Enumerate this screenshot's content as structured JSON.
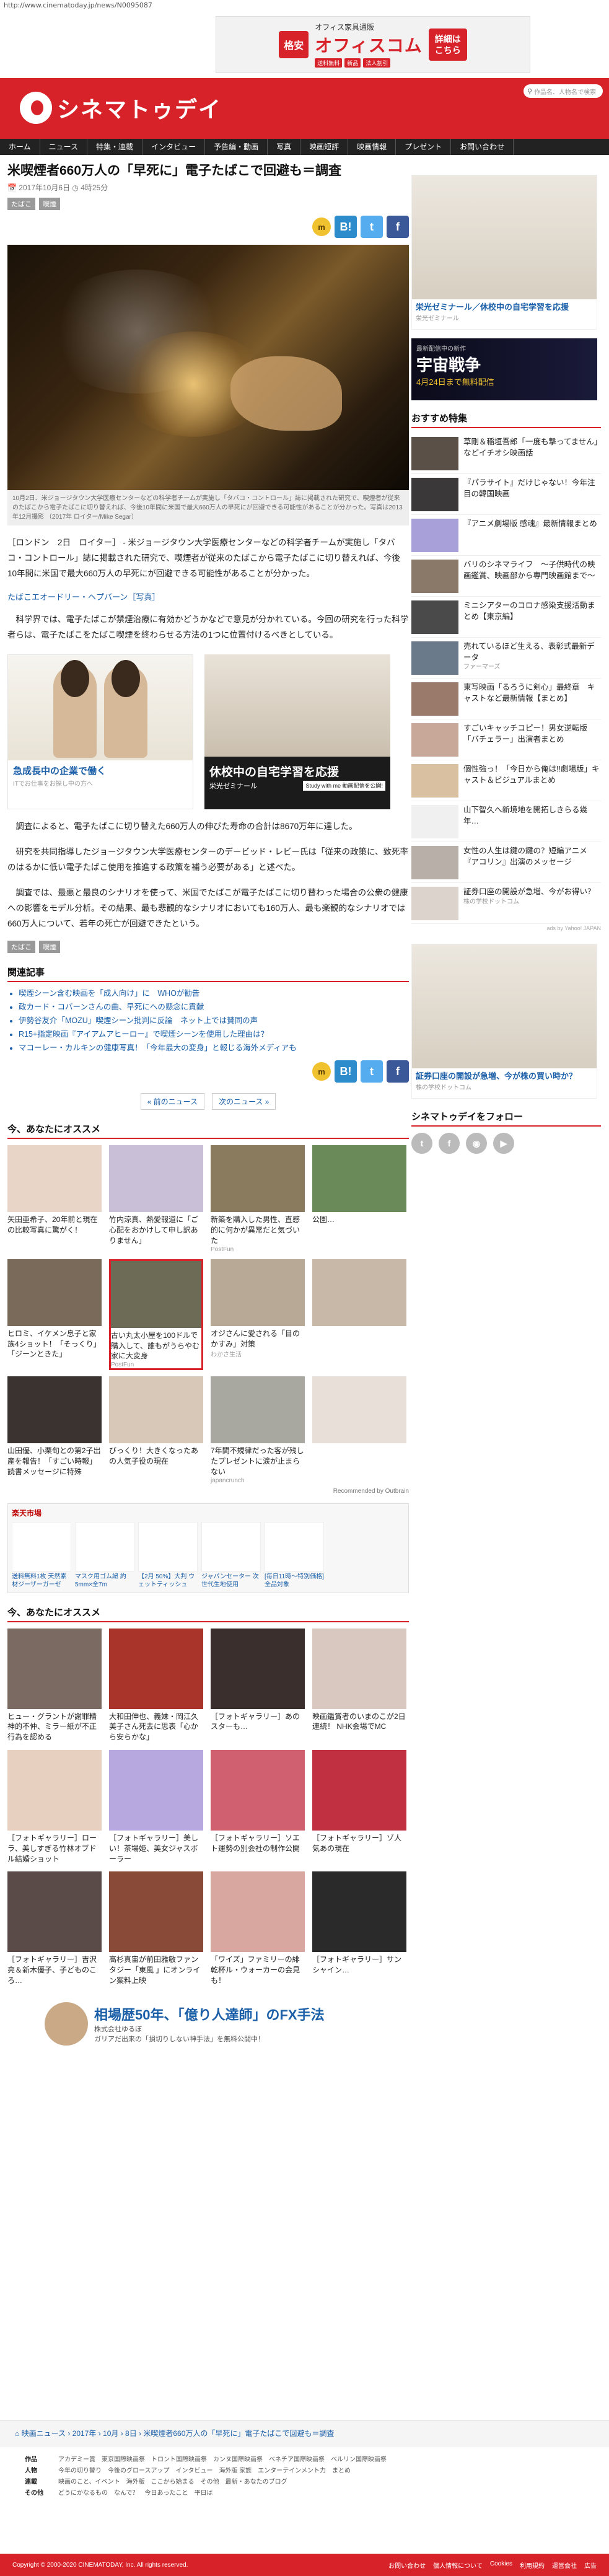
{
  "browser": {
    "url": "http://www.cinematoday.jp/news/N0095087"
  },
  "top_ad": {
    "tag": "格安",
    "sub": "オフィス家具通販",
    "main": "オフィスコム",
    "pills": [
      "送料無料",
      "新品",
      "法人割引"
    ],
    "cta": "詳細は\nこちら"
  },
  "header": {
    "logo_text": "シネマトゥデイ",
    "search_placeholder": "作品名、人物名で検索"
  },
  "nav": [
    "ホーム",
    "ニュース",
    "特集・連載",
    "インタビュー",
    "予告編・動画",
    "写真",
    "映画短評",
    "映画情報",
    "プレゼント",
    "お問い合わせ"
  ],
  "article": {
    "title": "米喫煙者660万人の「早死に」電子たばこで回避も＝調査",
    "date": "2017年10月6日",
    "time": "4時25分",
    "tags": [
      "たばこ",
      "喫煙"
    ],
    "caption": "10月2日、米ジョージタウン大学医療センターなどの科学者チームが実施し「タバコ・コントロール」誌に掲載された研究で、喫煙者が従来のたばこから電子たばこに切り替えれば、今後10年間に米国で最大660万人の早死にが回避できる可能性があることが分かった。写真は2013年12月撮影 （2017年 ロイター/Mike Segar）",
    "p1": "［ロンドン　2日　ロイター］ - 米ジョージタウン大学医療センターなどの科学者チームが実施し「タバコ・コントロール」誌に掲載された研究で、喫煙者が従来のたばこから電子たばこに切り替えれば、今後10年間に米国で最大660万人の早死にが回避できる可能性があることが分かった。",
    "related_link": "たばこエオードリー・ヘプバーン［写真］",
    "p2": "　科学界では、電子たばこが禁煙治療に有効かどうかなどで意見が分かれている。今回の研究を行った科学者らは、電子たばこをたばこ喫煙を終わらせる方法の1つに位置付けるべきとしている。",
    "p3": "　調査によると、電子たばこに切り替えた660万人の伸びた寿命の合計は8670万年に達した。",
    "p4": "　研究を共同指導したジョージタウン大学医療センターのデービッド・レビー氏は「従来の政策に、致死率のはるかに低い電子たばこ使用を推進する政策を補う必要がある」と述べた。",
    "p5": "　調査では、最悪と最良のシナリオを使って、米国でたばこが電子たばこに切り替わった場合の公衆の健康への影響をモデル分析。その結果、最も悲観的なシナリオにおいても160万人、最も楽観的なシナリオでは660万人について、若年の死亡が回避できたという。",
    "pr_label": "[PR]"
  },
  "share": {
    "mixi": "m",
    "hatena": "B!",
    "twitter": "t",
    "facebook": "f"
  },
  "inline_ads": {
    "a_title": "急成長中の企業で働く",
    "a_src": "ITでお仕事をお探し中の方へ",
    "b_text": "休校中の自宅学習を応援",
    "b_brand": "栄光ゼミナール",
    "b_cta": "Study with me 動画配信を公開!"
  },
  "related": {
    "title": "関連記事",
    "items": [
      "喫煙シーン含む映画を「成人向け」に　WHOが勧告",
      "政カード・コバーンさんの曲、早死にへの懸念に貢献",
      "伊勢谷友介「MOZU」喫煙シーン批判に反論　ネット上では賛同の声",
      "R15+指定映画『アイアムアヒーロー』で喫煙シーンを使用した理由は？",
      "マコーレー・カルキンの健康写真！「今年最大の変身」と報じる海外メディアも"
    ]
  },
  "pager": {
    "prev": "« 前のニュース",
    "next": "次のニュース »"
  },
  "rec1": {
    "title": "今、あなたにオススメ",
    "items": [
      {
        "cap": "矢田亜希子、20年前と現在の比較写真に驚がく！",
        "src": ""
      },
      {
        "cap": "竹内涼真、熱愛報道に「ご心配をおかけして申し訳ありません」",
        "src": ""
      },
      {
        "cap": "新築を購入した男性、直感的に何かが異常だと気づいた",
        "src": "PostFun"
      },
      {
        "cap": "公園…",
        "src": ""
      },
      {
        "cap": "ヒロミ、イケメン息子と家族4ショット！「そっくり」「ジーンときた」",
        "src": ""
      },
      {
        "cap": "古い丸太小屋を100ドルで購入して、誰もがうらやむ家に大変身",
        "src": "PostFun"
      },
      {
        "cap": "オジさんに愛される「目のかすみ」対策",
        "src": "わかさ生活"
      },
      {
        "cap": "",
        "src": ""
      },
      {
        "cap": "山田優、小栗旬との第2子出産を報告！「すごい時報」読書メッセージに特殊",
        "src": ""
      },
      {
        "cap": "びっくり！大きくなったあの人気子役の現在",
        "src": ""
      },
      {
        "cap": "7年間不規律だった客が残したプレゼントに涙が止まらない",
        "src": "japancrunch"
      },
      {
        "cap": "",
        "src": ""
      }
    ],
    "recommended_by": "Recommended by Outbrain"
  },
  "rakuten": {
    "head": "楽天市場",
    "items": [
      "送料無料1枚 天然素材ジーザーガーゼ",
      "マスク用ゴム紐 約5mm×全7m",
      "【2月 50%】大判 ウェットティッシュ",
      "ジャパンセーター 次世代生地使用",
      "[毎日11時〜特別価格] 全品対象"
    ]
  },
  "rec2": {
    "title": "今、あなたにオススメ",
    "items": [
      "ヒュー・グラントが謝罪精神的不仲、ミラー紙が不正行為を認める",
      "大和田伸也、義妹・岡江久美子さん死去に思表「心から安らかな」",
      "［フォトギャラリー］あのスターも…",
      "映画鑑賞者のいまのこが2日連続！ NHK会場でMC",
      "［フォトギャラリー］ローラ、美しすぎる竹林オブドル結婚ショット",
      "［フォトギャラリー］美しい！茶場姫、美女ジャスボーラー",
      "［フォトギャラリー］ソエト運勢の別会社の制作公開",
      "［フォトギャラリー］ゾ人気あの現在",
      "［フォトギャラリー］吉沢亮＆新木優子、子どものころ…",
      "高杉真宙が前田雅敏ファンタジー「東風 」にオンライン案料上映",
      "「ワイズ」ファミリーの緋　乾杯ル・ウォーカーの会見も！",
      "［フォトギャラリー］サンシャイン…"
    ]
  },
  "bottom_ad": {
    "title": "相場歴50年、「億り人達師」のFX手法",
    "sub": "株式会社ゆるぼ",
    "desc": "ガリアだ出来の「損切りしない神手法」を無料公開中！"
  },
  "sidebar": {
    "ad1_cap": "栄光ゼミナール／休校中の自宅学習を応援",
    "ad1_src": "栄光ゼミナール",
    "movie_label": "最新配信中の新作",
    "movie_name": "宇宙戦争",
    "movie_date": "4月24日まで無料配信",
    "special_title": "おすすめ特集",
    "specials": [
      {
        "t": "草剛＆稲垣吾郎「一度も撃ってません」などイチオシ映画話",
        "s": ""
      },
      {
        "t": "『パラサイト』だけじゃない！今年注目の韓国映画",
        "s": ""
      },
      {
        "t": "『アニメ劇場版 感魂』最新情報まとめ",
        "s": ""
      },
      {
        "t": "バリのシネマライフ　～子供時代の映画鑑賞、映画部から専門映画館まで～",
        "s": ""
      },
      {
        "t": "ミニシアターのコロナ感染支援活動まとめ【東京編】",
        "s": ""
      },
      {
        "t": "売れているほど生える、表彰式最新データ",
        "s": "ファーマーズ"
      },
      {
        "t": "東写映画「るろうに剣心」最終章　キャストなど最新情報【まとめ】",
        "s": ""
      },
      {
        "t": "すごいキャッチコピー！男女逆転版「バチェラー」出演者まとめ",
        "s": ""
      },
      {
        "t": "個性強っ！「今日から俺は!!劇場版」キャスト＆ビジュアルまとめ",
        "s": ""
      },
      {
        "t": "山下智久へ新境地を開拓しきらる幾年…",
        "s": ""
      },
      {
        "t": "女性の人生は鍵の鍵の？短編アニメ『アコリン』出演のメッセージ",
        "s": ""
      },
      {
        "t": "証券口座の開設が急増、今がお得い？",
        "s": "株の学校ドットコム"
      }
    ],
    "ads_by": "ads by Yahoo! JAPAN",
    "ad2_cap": "証券口座の開設が急増、今が株の買い時か？",
    "ad2_src": "株の学校ドットコム",
    "follow_title": "シネマトゥデイをフォロー",
    "follow_icons": [
      "twitter",
      "facebook",
      "instagram",
      "youtube"
    ]
  },
  "breadcrumb": "映画ニュース › 2017年 › 10月 › 8日 › 米喫煙者660万人の「早死に」電子たばこで回避も＝調査",
  "footer": {
    "rows": [
      {
        "label": "作品",
        "links": [
          "アカデミー賞",
          "東京国際映画祭",
          "トロント国際映画祭",
          "カンヌ国際映画祭",
          "ベネチア国際映画祭",
          "ベルリン国際映画祭"
        ]
      },
      {
        "label": "人物",
        "links": [
          "今年の切り替り",
          "今後のグロースアップ",
          "インタビュー",
          "海外版 家族",
          "エンターテインメント力",
          "まとめ"
        ]
      },
      {
        "label": "連載",
        "links": [
          "映画のこと、イベント",
          "海外版",
          "ここから始まる",
          "その他",
          "最新・あなたのブログ"
        ]
      },
      {
        "label": "その他",
        "links": [
          "どうにかなるもの",
          "なんで？",
          "今日あったこと",
          "平日は"
        ]
      }
    ],
    "copyright": "Copyright © 2000-2020 CINEMATODAY, Inc. All rights reserved.",
    "links": [
      "お問い合わせ",
      "個人情報について",
      "Cookies",
      "利用規約",
      "運営会社",
      "広告"
    ]
  }
}
